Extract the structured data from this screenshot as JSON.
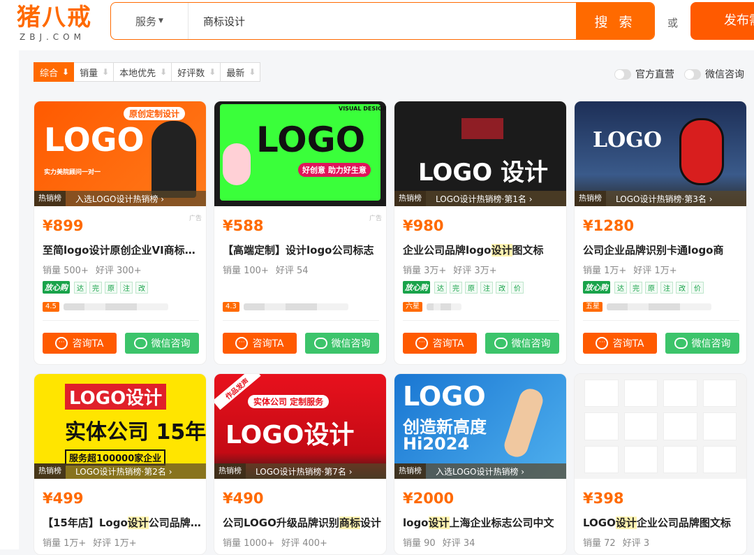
{
  "brand": {
    "cn": "猪八戒",
    "en": "ZBJ.COM"
  },
  "search": {
    "category": "服务",
    "value": "商标设计",
    "button": "搜 索"
  },
  "or_text": "或",
  "publish": "发布需求",
  "sort": [
    {
      "label": "综合"
    },
    {
      "label": "销量"
    },
    {
      "label": "本地优先"
    },
    {
      "label": "好评数"
    },
    {
      "label": "最新"
    }
  ],
  "toggles": {
    "official": "官方直营",
    "wechat": "微信咨询"
  },
  "buttons": {
    "ask": "咨询TA",
    "wechat": "微信咨询"
  },
  "hot_tag": "热销榜",
  "ad_label": "广告",
  "badges": {
    "fangxin": "放心购",
    "guarantees": [
      "达",
      "完",
      "原",
      "注",
      "改",
      "价"
    ]
  },
  "cards": [
    {
      "thumb": {
        "line1": "LOGO",
        "line2": "原创定制设计",
        "line3": "实力美院顾问一对一"
      },
      "hot": "入选LOGO设计热销榜 ›",
      "price": "¥899",
      "title": "至简logo设计原创企业VI商标设计",
      "sales": "销量 500+",
      "reviews": "好评 300+",
      "rating": "4.5"
    },
    {
      "thumb": {
        "line1": "LOGO",
        "line2": "好创意 助力好生意",
        "line3": "VISUAL DESIGN"
      },
      "hot": "",
      "price": "¥588",
      "title": "【高端定制】设计logo公司标志",
      "sales": "销量 100+",
      "reviews": "好评 54",
      "rating": "4.3"
    },
    {
      "thumb": {
        "line1": "LOGO 设计",
        "line2": "",
        "line3": ""
      },
      "hot": "LOGO设计热销榜·第1名 ›",
      "price": "¥980",
      "title_pre": "企业公司品牌logo",
      "title_hl": "设计",
      "title_post": "图文标",
      "sales": "销量 3万+",
      "reviews": "好评 3万+",
      "rating": "六星"
    },
    {
      "thumb": {
        "line1": "LOGO",
        "line2": "",
        "line3": ""
      },
      "hot": "LOGO设计热销榜·第3名 ›",
      "price": "¥1280",
      "title": "公司企业品牌识别卡通logo商",
      "sales": "销量 1万+",
      "reviews": "好评 1万+",
      "rating": "五星"
    },
    {
      "thumb": {
        "line1": "LOGO设计",
        "line2": "实体公司 15年",
        "line3": "服务超100000家企业"
      },
      "hot": "LOGO设计热销榜·第2名 ›",
      "price": "¥499",
      "title_pre": "【15年店】Logo",
      "title_hl": "设计",
      "title_post": "公司品牌商标",
      "sales": "销量 1万+",
      "reviews": "好评 1万+"
    },
    {
      "thumb": {
        "line1": "LOGO设计",
        "line2": "实体公司 定制服务",
        "line3": "作品发声"
      },
      "hot": "LOGO设计热销榜·第7名 ›",
      "price": "¥490",
      "title_pre": "公司LOGO升级品牌识别",
      "title_hl": "商标",
      "title_post": "设计",
      "sales": "销量 1000+",
      "reviews": "好评 400+"
    },
    {
      "thumb": {
        "line1": "LOGO",
        "line2": "创造新高度",
        "line3": "Hi2024"
      },
      "hot": "入选LOGO设计热销榜 ›",
      "price": "¥2000",
      "title_pre": "logo",
      "title_hl": "设计",
      "title_post": "上海企业标志公司中文",
      "sales": "销量 90",
      "reviews": "好评 34"
    },
    {
      "thumb": {
        "line1": "",
        "line2": "",
        "line3": ""
      },
      "hot": "",
      "price": "¥398",
      "title_pre": "LOGO",
      "title_hl": "设计",
      "title_post": "企业公司品牌图文标",
      "sales": "销量 72",
      "reviews": "好评 3"
    }
  ],
  "colors": {
    "accent": "#ff6a00",
    "wechat": "#3cc46b",
    "guarantee": "#19a34a"
  }
}
